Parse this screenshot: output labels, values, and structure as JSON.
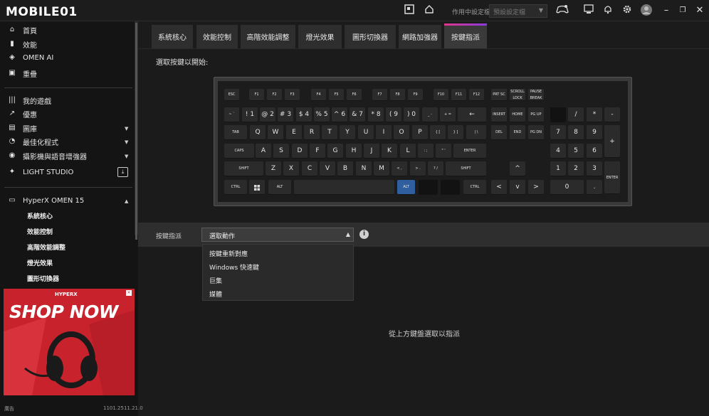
{
  "topbar": {
    "logo_text": "MOBILE01",
    "in_use_label": "作用中設定檔",
    "preset_placeholder": "預設設定檔",
    "icons": [
      "tag-icon",
      "home-icon",
      "gamepad-icon",
      "monitor-icon",
      "bell-icon",
      "gear-icon",
      "avatar-icon",
      "minimize-icon",
      "restore-icon",
      "close-icon"
    ]
  },
  "sidebar": {
    "primary": [
      {
        "label": "首頁",
        "icon": "home-icon"
      },
      {
        "label": "效能",
        "icon": "bar-chart-icon"
      },
      {
        "label": "OMEN AI",
        "icon": "diamond-icon"
      },
      {
        "label": "重疊",
        "icon": "overlay-icon"
      }
    ],
    "games": [
      {
        "label": "我的遊戲",
        "icon": "library-icon",
        "caret": false
      },
      {
        "label": "優惠",
        "icon": "trend-icon",
        "caret": false
      },
      {
        "label": "圖庫",
        "icon": "gallery-icon",
        "caret": true
      },
      {
        "label": "最佳化程式",
        "icon": "gauge-icon",
        "caret": true
      },
      {
        "label": "攝影機與語音增強器",
        "icon": "camera-icon",
        "caret": true
      },
      {
        "label": "LIGHT STUDIO",
        "icon": "sparkle-icon",
        "caret": false
      }
    ],
    "device": {
      "name": "HyperX OMEN 15",
      "icon": "laptop-icon",
      "items": [
        "系統核心",
        "效能控制",
        "高階效能調整",
        "燈光效果",
        "圖形切換器"
      ]
    },
    "ad": {
      "brand": "HYPERX",
      "headline": "SHOP NOW"
    },
    "footer_left": "廣告",
    "version": "1101.2511.21.0"
  },
  "tabs": [
    {
      "label": "系統核心",
      "active": false
    },
    {
      "label": "效能控制",
      "active": false
    },
    {
      "label": "高階效能調整",
      "active": false
    },
    {
      "label": "燈光效果",
      "active": false
    },
    {
      "label": "圖形切換器",
      "active": false
    },
    {
      "label": "網路加強器",
      "active": false
    },
    {
      "label": "按鍵指派",
      "active": true
    }
  ],
  "main": {
    "prompt": "選取按鍵以開始:",
    "assign_label": "按鍵指派",
    "select_value": "選取動作",
    "options": [
      "按鍵重新對應",
      "Windows 快速鍵",
      "巨集",
      "媒體"
    ],
    "hint": "從上方鍵盤選取以指派"
  },
  "keyboard": {
    "selected_key": "ALT",
    "rows": {
      "fn": [
        "ESC",
        "F1",
        "F2",
        "F3",
        "F4",
        "F5",
        "F6",
        "F7",
        "F8",
        "F9",
        "F10",
        "F11",
        "F12",
        "PRT SC",
        "SCROLL LOCK",
        "PAUSE BREAK"
      ],
      "num": [
        "~ `",
        "! 1",
        "@ 2",
        "# 3",
        "$ 4",
        "% 5",
        "^ 6",
        "& 7",
        "* 8",
        "( 9",
        ") 0",
        "_ -",
        "+ =",
        "←",
        "INSERT",
        "HOME",
        "PG UP",
        "",
        "/",
        "*",
        "-"
      ],
      "top": [
        "TAB",
        "Q",
        "W",
        "E",
        "R",
        "T",
        "Y",
        "U",
        "I",
        "O",
        "P",
        "{ [",
        "} ]",
        "| \\",
        "DEL",
        "END",
        "PG DN",
        "7",
        "8",
        "9",
        "+"
      ],
      "home": [
        "CAPS",
        "A",
        "S",
        "D",
        "F",
        "G",
        "H",
        "J",
        "K",
        "L",
        ": ;",
        "\" '",
        "ENTER",
        "4",
        "5",
        "6"
      ],
      "shift": [
        "SHIFT",
        "Z",
        "X",
        "C",
        "V",
        "B",
        "N",
        "M",
        "< ,",
        "> .",
        "? /",
        "SHIFT",
        "^",
        "1",
        "2",
        "3",
        "ENTER"
      ],
      "bottom": [
        "CTRL",
        "WIN",
        "ALT",
        "",
        "ALT",
        "",
        "",
        "CTRL",
        "<",
        "v",
        ">",
        "0",
        "."
      ]
    }
  }
}
